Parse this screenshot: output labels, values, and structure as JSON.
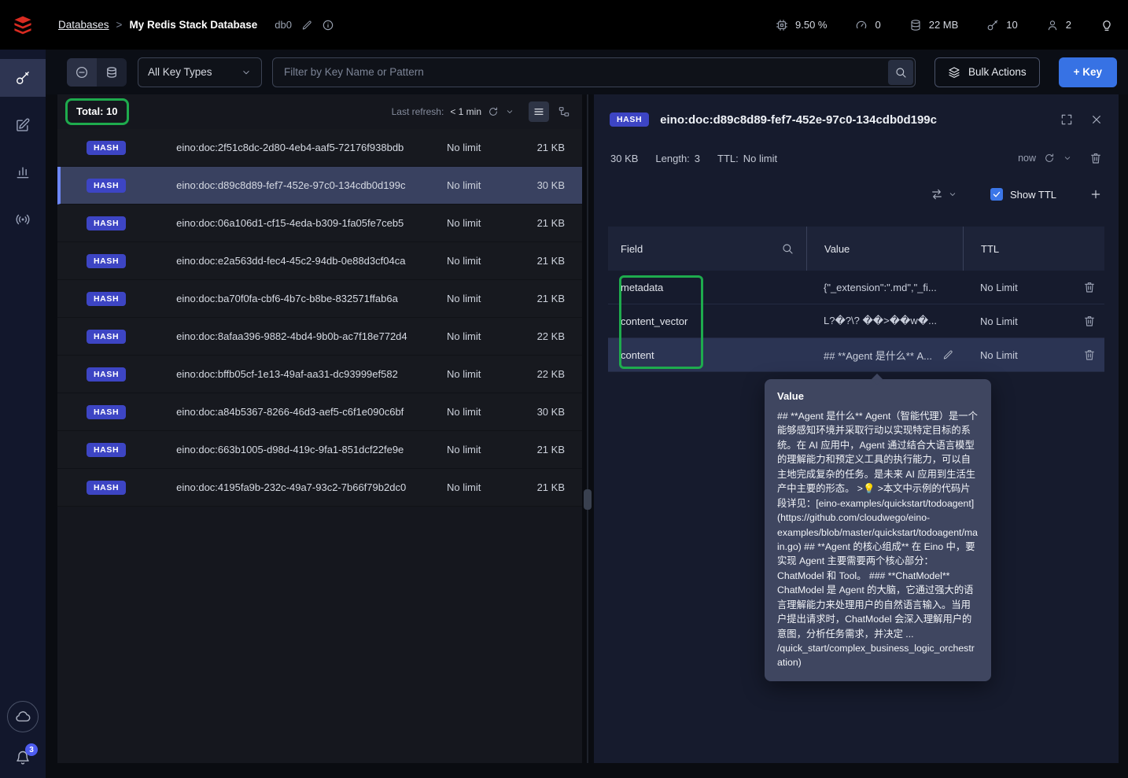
{
  "colors": {
    "annotation_green": "#1eab4d",
    "hash_badge": "#3d45c4",
    "primary_button_blue": "#3772e4",
    "checkbox_blue": "#3b76e8"
  },
  "sidebar": {
    "items": [
      {
        "id": "browser",
        "icon": "key-icon",
        "active": true
      },
      {
        "id": "workbench",
        "icon": "edit-icon",
        "active": false
      },
      {
        "id": "analytics",
        "icon": "chart-icon",
        "active": false
      },
      {
        "id": "pub-sub",
        "icon": "broadcast-icon",
        "active": false
      }
    ],
    "cloud_icon": "cloud-icon",
    "notifications": {
      "icon": "bell-icon",
      "badge": "3"
    }
  },
  "header": {
    "breadcrumb": {
      "root": "Databases",
      "separator": ">",
      "current": "My Redis Stack Database"
    },
    "db_index": "db0",
    "stats": [
      {
        "id": "cpu-usage",
        "icon": "cpu-icon",
        "value": "9.50 %"
      },
      {
        "id": "commands-per-sec",
        "icon": "gauge-icon",
        "value": "0"
      },
      {
        "id": "total-memory",
        "icon": "database-icon",
        "value": "22 MB"
      },
      {
        "id": "total-keys",
        "icon": "key-icon",
        "value": "10"
      },
      {
        "id": "connected-clients",
        "icon": "user-icon",
        "value": "2"
      }
    ]
  },
  "filter_bar": {
    "key_type_filter": "All Key Types",
    "search_placeholder": "Filter by Key Name or Pattern",
    "bulk_actions_label": "Bulk Actions",
    "add_key_label": "+ Key"
  },
  "key_list": {
    "total_label": "Total: 10",
    "refresh_label": "Last refresh:",
    "refresh_value": "< 1 min",
    "rows": [
      {
        "type": "HASH",
        "name": "eino:doc:2f51c8dc-2d80-4eb4-aaf5-72176f938bdb",
        "ttl": "No limit",
        "size": "21 KB"
      },
      {
        "type": "HASH",
        "name": "eino:doc:d89c8d89-fef7-452e-97c0-134cdb0d199c",
        "ttl": "No limit",
        "size": "30 KB"
      },
      {
        "type": "HASH",
        "name": "eino:doc:06a106d1-cf15-4eda-b309-1fa05fe7ceb5",
        "ttl": "No limit",
        "size": "21 KB"
      },
      {
        "type": "HASH",
        "name": "eino:doc:e2a563dd-fec4-45c2-94db-0e88d3cf04ca",
        "ttl": "No limit",
        "size": "21 KB"
      },
      {
        "type": "HASH",
        "name": "eino:doc:ba70f0fa-cbf6-4b7c-b8be-832571ffab6a",
        "ttl": "No limit",
        "size": "21 KB"
      },
      {
        "type": "HASH",
        "name": "eino:doc:8afaa396-9882-4bd4-9b0b-ac7f18e772d4",
        "ttl": "No limit",
        "size": "22 KB"
      },
      {
        "type": "HASH",
        "name": "eino:doc:bffb05cf-1e13-49af-aa31-dc93999ef582",
        "ttl": "No limit",
        "size": "22 KB"
      },
      {
        "type": "HASH",
        "name": "eino:doc:a84b5367-8266-46d3-aef5-c6f1e090c6bf",
        "ttl": "No limit",
        "size": "30 KB"
      },
      {
        "type": "HASH",
        "name": "eino:doc:663b1005-d98d-419c-9fa1-851dcf22fe9e",
        "ttl": "No limit",
        "size": "21 KB"
      },
      {
        "type": "HASH",
        "name": "eino:doc:4195fa9b-232c-49a7-93c2-7b66f79b2dc0",
        "ttl": "No limit",
        "size": "21 KB"
      }
    ]
  },
  "details": {
    "type_badge": "HASH",
    "key_name": "eino:doc:d89c8d89-fef7-452e-97c0-134cdb0d199c",
    "size": "30 KB",
    "length_label": "Length:",
    "length_value": "3",
    "ttl_label": "TTL:",
    "ttl_value": "No limit",
    "refreshed_value": "now",
    "show_ttl_label": "Show TTL",
    "table": {
      "headers": {
        "field": "Field",
        "value": "Value",
        "ttl": "TTL"
      },
      "rows": [
        {
          "field": "metadata",
          "value": "{\"_extension\":\".md\",\"_fi...",
          "ttl": "No Limit"
        },
        {
          "field": "content_vector",
          "value": "L?�?\\? ��>��w�...",
          "ttl": "No Limit"
        },
        {
          "field": "content",
          "value": "## **Agent 是什么** A...",
          "ttl": "No Limit"
        }
      ]
    },
    "tooltip": {
      "title": "Value",
      "body": "## **Agent 是什么** Agent（智能代理）是一个能够感知环境并采取行动以实现特定目标的系统。在 AI 应用中，Agent 通过结合大语言模型的理解能力和预定义工具的执行能力，可以自主地完成复杂的任务。是未来 AI 应用到生活生产中主要的形态。 >💡 >本文中示例的代码片段详见：[eino-examples/quickstart/todoagent](https://github.com/cloudwego/eino-examples/blob/master/quickstart/todoagent/main.go) ## **Agent 的核心组成** 在 Eino 中，要实现 Agent 主要需要两个核心部分：ChatModel 和 Tool。 ### **ChatModel** ChatModel 是 Agent 的大脑，它通过强大的语言理解能力来处理用户的自然语言输入。当用户提出请求时，ChatModel 会深入理解用户的意图，分析任务需求，并决定 ...\n/quick_start/complex_business_logic_orchestration)"
    }
  }
}
